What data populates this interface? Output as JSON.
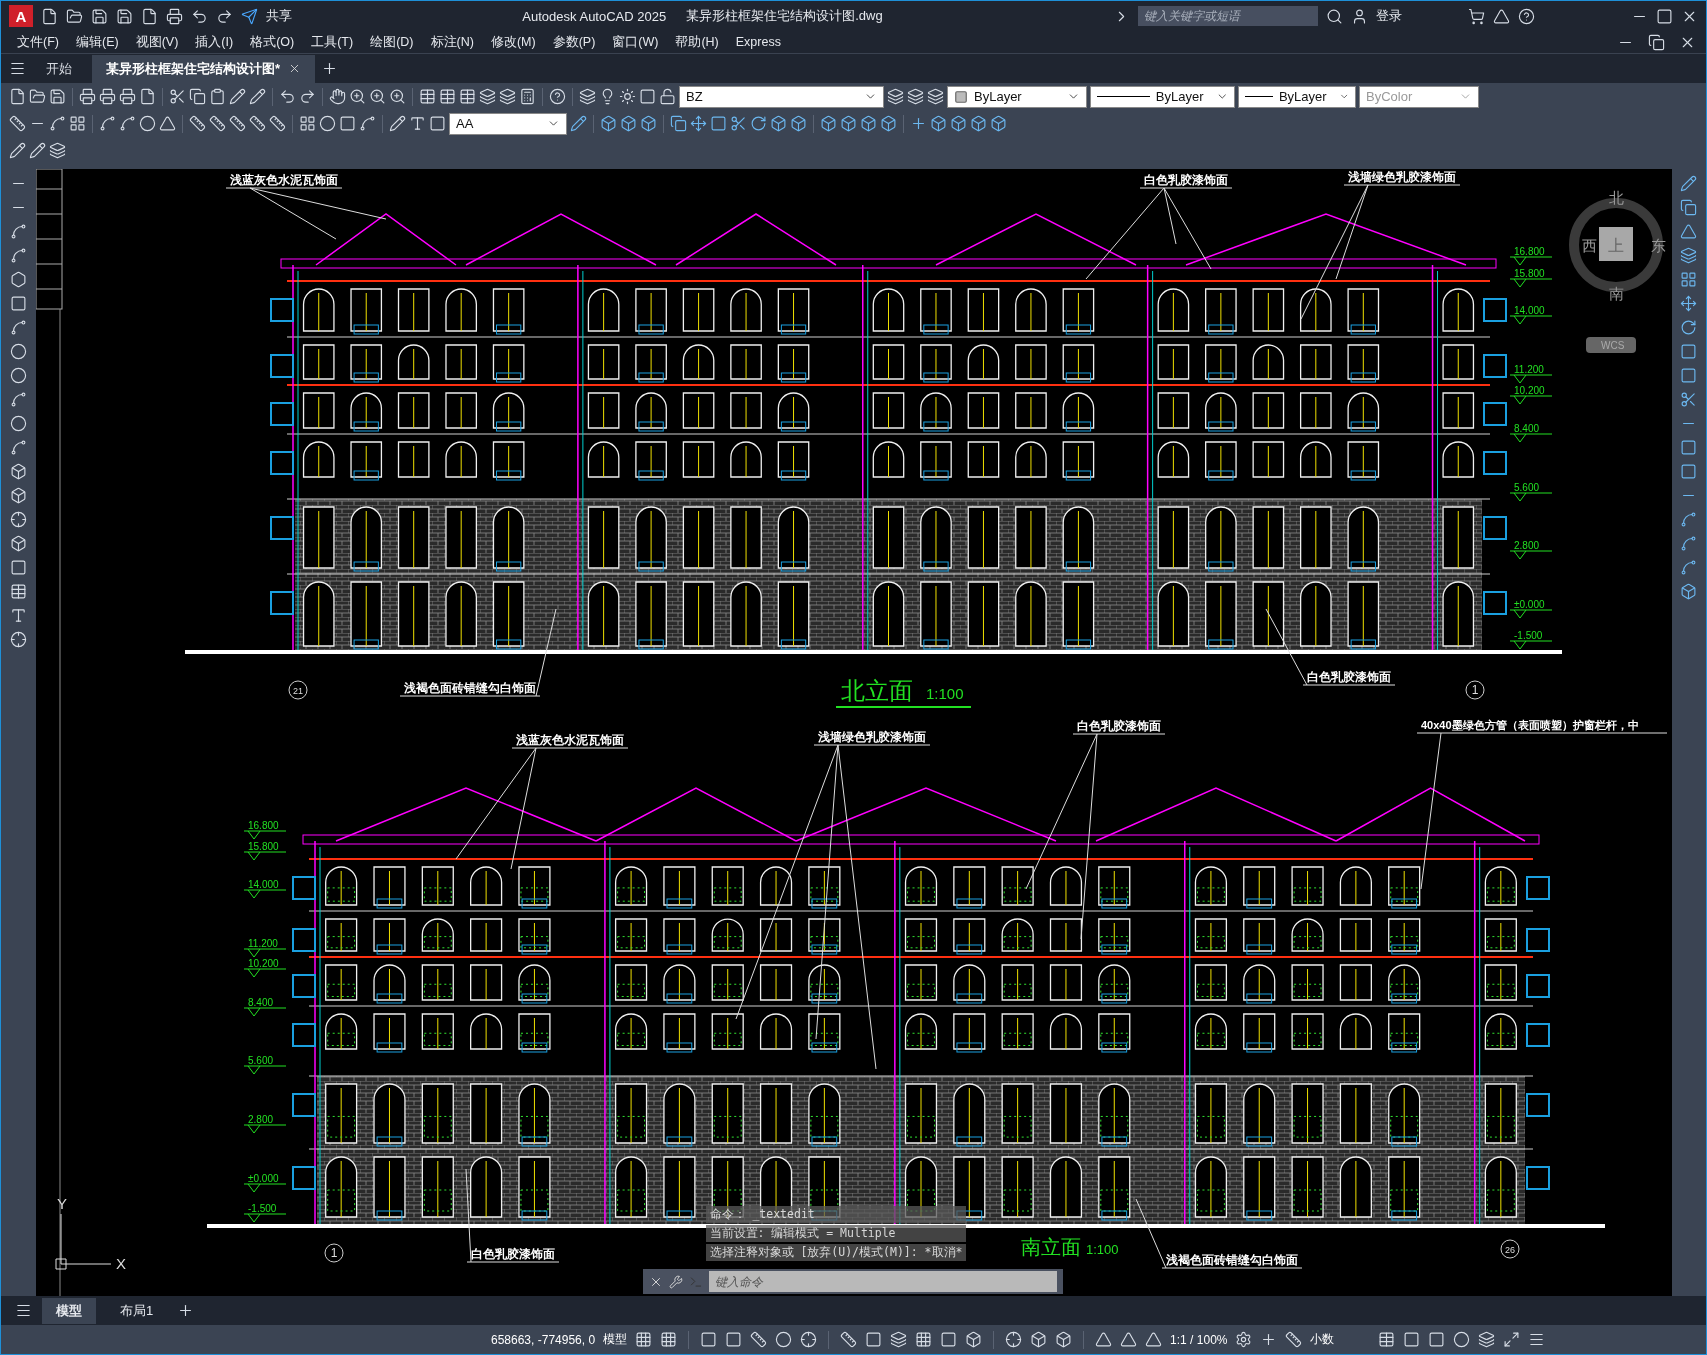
{
  "title_bar": {
    "app_icon": "A",
    "share": "共享",
    "title": "Autodesk AutoCAD 2025",
    "file": "某异形柱框架住宅结构设计图.dwg",
    "search": {
      "placeholder": "键入关键字或短语"
    },
    "login": "登录"
  },
  "menu": [
    "文件(F)",
    "编辑(E)",
    "视图(V)",
    "插入(I)",
    "格式(O)",
    "工具(T)",
    "绘图(D)",
    "标注(N)",
    "修改(M)",
    "参数(P)",
    "窗口(W)",
    "帮助(H)",
    "Express"
  ],
  "doc_tabs": [
    {
      "label": "开始",
      "selected": false
    },
    {
      "label": "某异形柱框架住宅结构设计图*",
      "selected": true
    }
  ],
  "toolbar": {
    "layer": "BZ",
    "text_style": "AA",
    "color_control": "ByLayer",
    "linetype": "ByLayer",
    "lineweight": "ByLayer",
    "plot_style": {
      "value": "ByColor",
      "disabled": true
    }
  },
  "drawing": {
    "north": {
      "title": "北立面",
      "scale": "1:100",
      "axes": [
        "21",
        "1"
      ],
      "annotations": [
        "浅蓝灰色水泥瓦饰面",
        "白色乳胶漆饰面",
        "浅墙绿色乳胶漆饰面",
        "浅褐色面砖错缝勾白饰面",
        "白色乳胶漆饰面"
      ],
      "levels": [
        "16.800",
        "15.800",
        "14.000",
        "11.200",
        "10.200",
        "8.400",
        "5.600",
        "2.800",
        "±0.000",
        "-1.500"
      ]
    },
    "south": {
      "title": "南立面",
      "scale": "1:100",
      "axes": [
        "1",
        "26"
      ],
      "annotations": [
        "浅蓝灰色水泥瓦饰面",
        "浅墙绿色乳胶漆饰面",
        "白色乳胶漆饰面",
        "40x40墨绿色方管（表面喷塑）护窗栏杆，中",
        "白色乳胶漆饰面",
        "浅褐色面砖错缝勾白饰面"
      ],
      "levels": [
        "16.800",
        "15.800",
        "14.000",
        "11.200",
        "10.200",
        "8.400",
        "5.600",
        "2.800",
        "±0.000",
        "-1.500"
      ]
    }
  },
  "viewcube": {
    "north": "北",
    "east": "东",
    "south": "南",
    "west": "西",
    "face": "上",
    "ucs": "WCS"
  },
  "ucs_icon": {
    "x": "X",
    "y": "Y"
  },
  "command": {
    "history": [
      "命令： _textedit",
      "当前设置: 编辑模式 = Multiple",
      "选择注释对象或 [放弃(U)/模式(M)]: *取消*"
    ],
    "placeholder": "键入命令"
  },
  "layout_tabs": [
    {
      "label": "模型",
      "selected": true
    },
    {
      "label": "布局1",
      "selected": false
    }
  ],
  "status_bar": {
    "coords": "658663, -774956, 0",
    "space": "模型",
    "scale": "1:1 / 100%",
    "units": "小数"
  }
}
